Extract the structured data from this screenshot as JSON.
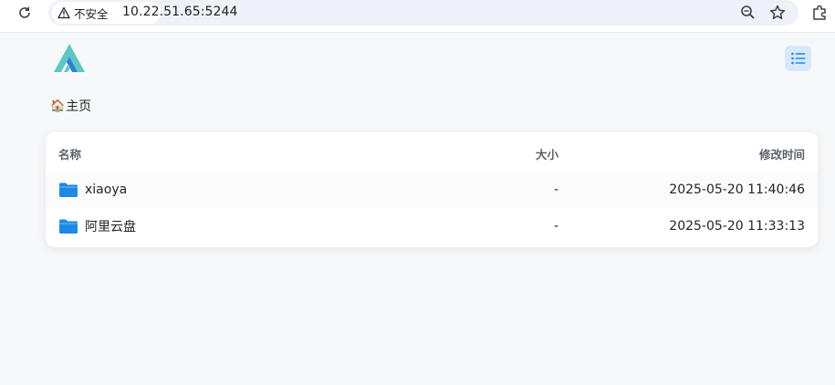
{
  "browser": {
    "security_label": "不安全",
    "url": "10.22.51.65:5244"
  },
  "breadcrumb": {
    "home_icon": "🏠",
    "home_label": "主页"
  },
  "table": {
    "headers": {
      "name": "名称",
      "size": "大小",
      "modified": "修改时间"
    },
    "rows": [
      {
        "icon": "folder-icon",
        "name": "xiaoya",
        "size": "-",
        "modified": "2025-05-20 11:40:46"
      },
      {
        "icon": "folder-icon",
        "name": "阿里云盘",
        "size": "-",
        "modified": "2025-05-20 11:33:13"
      }
    ]
  },
  "colors": {
    "accent": "#1e88e5",
    "logo_teal": "#5fc6c3",
    "logo_blue": "#2f7fd8",
    "toggle_bg": "#d7e8fb"
  }
}
